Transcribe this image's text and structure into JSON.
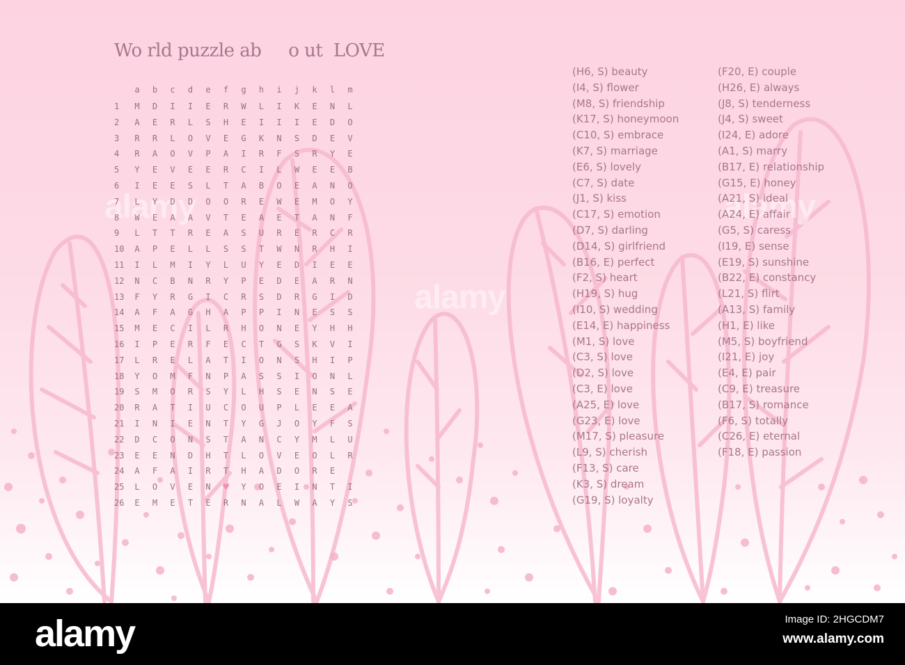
{
  "title": "Wo rld puzzle ab     o ut  LOVE",
  "grid": {
    "columns": [
      "a",
      "b",
      "c",
      "d",
      "e",
      "f",
      "g",
      "h",
      "i",
      "j",
      "k",
      "l",
      "m"
    ],
    "rows": [
      {
        "n": "1",
        "letters": "MDIIERWLIKENL"
      },
      {
        "n": "2",
        "letters": "AERLSHEIIIEDO"
      },
      {
        "n": "3",
        "letters": "RRLOVEGKNSDEV"
      },
      {
        "n": "4",
        "letters": "RAOVPAIRFSRYE"
      },
      {
        "n": "5",
        "letters": "YEVEERCILWEEB"
      },
      {
        "n": "6",
        "letters": "IEESLTABOEANO"
      },
      {
        "n": "7",
        "letters": "LYDDOOREWEMOY"
      },
      {
        "n": "8",
        "letters": "WEAAVTEAETANF"
      },
      {
        "n": "9",
        "letters": "LTTREASURERCR"
      },
      {
        "n": "10",
        "letters": "APELLSSTWNRHI"
      },
      {
        "n": "11",
        "letters": "ILMIYLUYEDIEE"
      },
      {
        "n": "12",
        "letters": "NCBNRYPEDEARN"
      },
      {
        "n": "13",
        "letters": "FYRGICRSDRGID"
      },
      {
        "n": "14",
        "letters": "AFAGHAPPINESS"
      },
      {
        "n": "15",
        "letters": "MECILRHONEYHH"
      },
      {
        "n": "16",
        "letters": "IPERFECTGSKVI"
      },
      {
        "n": "17",
        "letters": "LRELATIONSHIP"
      },
      {
        "n": "18",
        "letters": "YOMFNPASSIONL"
      },
      {
        "n": "19",
        "letters": "SMORSYLHSENSE"
      },
      {
        "n": "20",
        "letters": "RATIUCOUPLEEA"
      },
      {
        "n": "21",
        "letters": "INIENTYGJOYFS"
      },
      {
        "n": "22",
        "letters": "DCONSTANCYMLU"
      },
      {
        "n": "23",
        "letters": "EENDHTLOVEOLR"
      },
      {
        "n": "24",
        "letters": "AFAIRTHADORE"
      },
      {
        "n": "25",
        "letters": "LOVEN♥YOEINTI"
      },
      {
        "n": "26",
        "letters": "EMETERNALWAYS"
      }
    ]
  },
  "word_list": {
    "column1": [
      "(H6, S) beauty",
      "(I4, S) flower",
      "(M8, S) friendship",
      "(K17, S) honeymoon",
      "(C10, S) embrace",
      "(K7, S) marriage",
      "(E6, S) lovely",
      "(C7, S) date",
      "(J1, S) kiss",
      "(C17, S) emotion",
      "(D7, S) darling",
      "(D14, S) girlfriend",
      "(B16, E) perfect",
      "(F2, S) heart",
      "(H19, S) hug",
      "(I10, S) wedding",
      "(E14, E) happiness",
      "(M1, S) love",
      "(C3, S) love",
      "(D2, S) love",
      "(C3, E) love",
      "(A25, E) love",
      "(G23, E) love",
      "(M17, S) pleasure",
      "(L9, S) cherish",
      "(F13, S) care",
      "(K3, S) dream",
      "(G19, S) loyalty"
    ],
    "column2": [
      "(F20, E) couple",
      "(H26, E) always",
      "(J8, S) tenderness",
      "(J4, S) sweet",
      "(I24, E) adore",
      "(A1, S) marry",
      "(B17, E) relationship",
      "(G15, E) honey",
      "(A21, S) ideal",
      "(A24, E) affair",
      "(G5, S) caress",
      "(I19, E) sense",
      "(E19, S) sunshine",
      "(B22, E) constancy",
      "(L21, S) flirt",
      "(A13, S) family",
      "(H1, E) like",
      "(M5, S) boyfriend",
      "(I21, E) joy",
      "(E4, E) pair",
      "(C9, E) treasure",
      "(B17, S) romance",
      "(F6, S) totally",
      "(C26, E) eternal",
      "(F18, E) passion"
    ]
  },
  "watermark": {
    "text": "alamy"
  },
  "footer": {
    "logo": "alamy",
    "image_id": "Image ID: 2HGCDM7",
    "site": "www.alamy.com"
  },
  "colors": {
    "background_top": "#fdd3e1",
    "background_bottom": "#ffffff",
    "text": "#a8768d",
    "decor_pink": "#f7b9cf",
    "heart": "#f28fb2",
    "footer": "#000000"
  },
  "icons": {
    "grid_heart": "heart-icon"
  }
}
